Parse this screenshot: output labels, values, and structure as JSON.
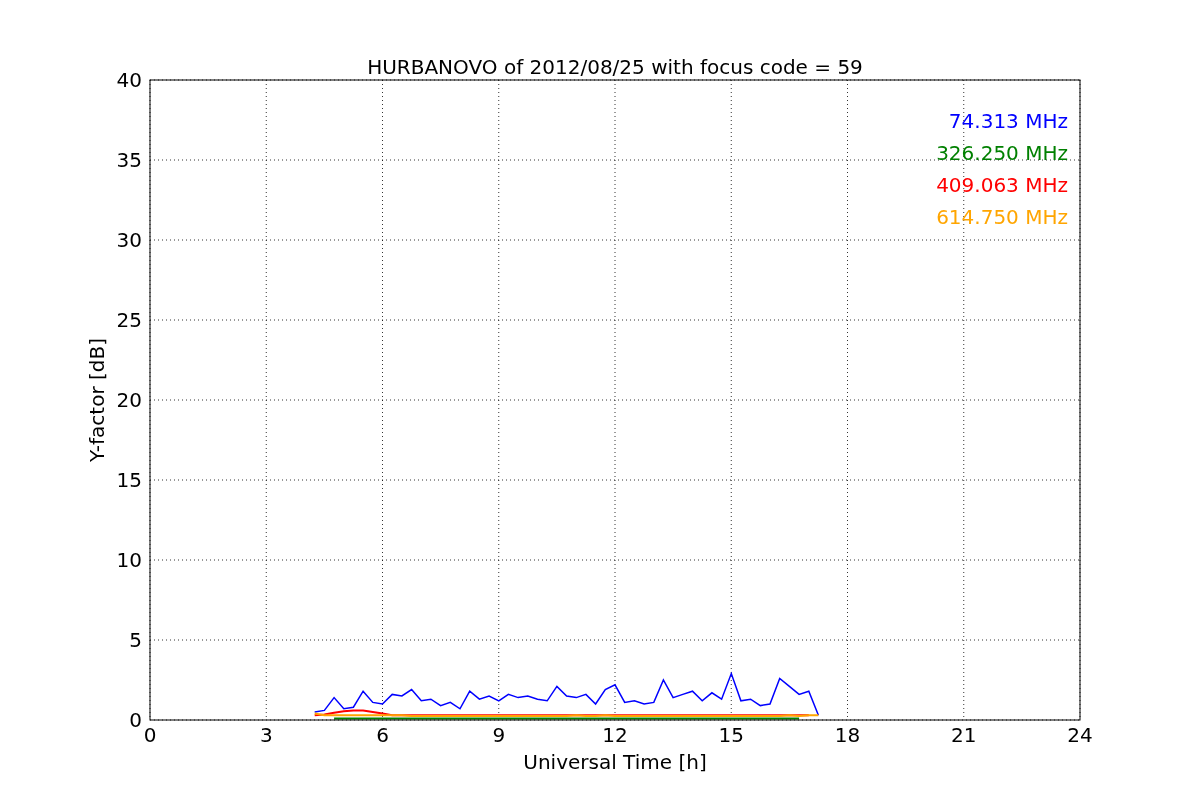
{
  "figure": {
    "chart_data": {
      "type": "line",
      "grid": true,
      "title": "HURBANOVO of 2012/08/25 with focus code = 59",
      "xlabel": "Universal Time [h]",
      "ylabel": "Y-factor [dB]",
      "xlim": [
        0,
        24
      ],
      "ylim": [
        0,
        40
      ],
      "xticks": [
        0,
        3,
        6,
        9,
        12,
        15,
        18,
        21,
        24
      ],
      "yticks": [
        0,
        5,
        10,
        15,
        20,
        25,
        30,
        35,
        40
      ],
      "x": [
        4.25,
        4.5,
        4.75,
        5,
        5.25,
        5.5,
        5.75,
        6,
        6.25,
        6.5,
        6.75,
        7,
        7.25,
        7.5,
        7.75,
        8,
        8.25,
        8.5,
        8.75,
        9,
        9.25,
        9.5,
        9.75,
        10,
        10.25,
        10.5,
        10.75,
        11,
        11.25,
        11.5,
        11.75,
        12,
        12.25,
        12.5,
        12.75,
        13,
        13.25,
        13.5,
        13.75,
        14,
        14.25,
        14.5,
        14.75,
        15,
        15.25,
        15.5,
        15.75,
        16,
        16.25,
        16.5,
        16.75,
        17,
        17.25
      ],
      "series": [
        {
          "name": "74.313 MHz",
          "color": "#0000ff",
          "values": [
            0.5,
            0.6,
            1.4,
            0.7,
            0.8,
            1.8,
            1.1,
            1.0,
            1.6,
            1.5,
            1.9,
            1.2,
            1.3,
            0.9,
            1.1,
            0.7,
            1.8,
            1.3,
            1.5,
            1.2,
            1.6,
            1.4,
            1.5,
            1.3,
            1.2,
            2.1,
            1.5,
            1.4,
            1.6,
            1.0,
            1.9,
            2.2,
            1.1,
            1.2,
            1.0,
            1.1,
            2.5,
            1.4,
            1.6,
            1.8,
            1.2,
            1.7,
            1.3,
            2.9,
            1.2,
            1.3,
            0.9,
            1.0,
            2.6,
            2.1,
            1.6,
            1.8,
            0.3
          ]
        },
        {
          "name": "326.250 MHz",
          "color": "#008000",
          "values": [
            null,
            null,
            0.1,
            0.1,
            0.1,
            0.1,
            0.1,
            0.1,
            0.1,
            0.1,
            0.1,
            0.1,
            0.1,
            0.1,
            0.1,
            0.1,
            0.1,
            0.1,
            0.1,
            0.1,
            0.1,
            0.1,
            0.1,
            0.1,
            0.1,
            0.1,
            0.1,
            0.1,
            0.1,
            0.1,
            0.1,
            0.1,
            0.1,
            0.1,
            0.1,
            0.1,
            0.1,
            0.1,
            0.1,
            0.1,
            0.1,
            0.1,
            0.1,
            0.1,
            0.1,
            0.1,
            0.1,
            0.1,
            0.1,
            0.1,
            0.1,
            null,
            null
          ]
        },
        {
          "name": "409.063 MHz",
          "color": "#ff0000",
          "values": [
            0.3,
            0.35,
            0.45,
            0.55,
            0.6,
            0.6,
            0.5,
            0.4,
            0.3,
            0.3,
            0.3,
            0.3,
            0.3,
            0.3,
            0.3,
            0.3,
            0.3,
            0.3,
            0.3,
            0.3,
            0.3,
            0.3,
            0.3,
            0.3,
            0.3,
            0.3,
            0.3,
            0.3,
            0.3,
            0.3,
            0.3,
            0.3,
            0.3,
            0.3,
            0.3,
            0.3,
            0.3,
            0.3,
            0.3,
            0.3,
            0.3,
            0.3,
            0.3,
            0.3,
            0.3,
            0.3,
            0.3,
            0.3,
            0.3,
            0.3,
            0.3,
            0.3,
            null
          ]
        },
        {
          "name": "614.750 MHz",
          "color": "#ffa500",
          "values": [
            0.4,
            0.3,
            0.3,
            0.3,
            0.3,
            0.3,
            0.3,
            0.3,
            0.3,
            0.3,
            0.25,
            0.25,
            0.25,
            0.25,
            0.25,
            0.25,
            0.25,
            0.25,
            0.25,
            0.25,
            0.25,
            0.25,
            0.25,
            0.25,
            0.25,
            0.25,
            0.25,
            0.3,
            0.25,
            0.25,
            0.3,
            0.25,
            0.25,
            0.25,
            0.25,
            0.25,
            0.25,
            0.25,
            0.25,
            0.25,
            0.25,
            0.25,
            0.25,
            0.25,
            0.25,
            0.25,
            0.25,
            0.25,
            0.25,
            0.3,
            0.25,
            0.3,
            0.3
          ]
        }
      ]
    }
  }
}
